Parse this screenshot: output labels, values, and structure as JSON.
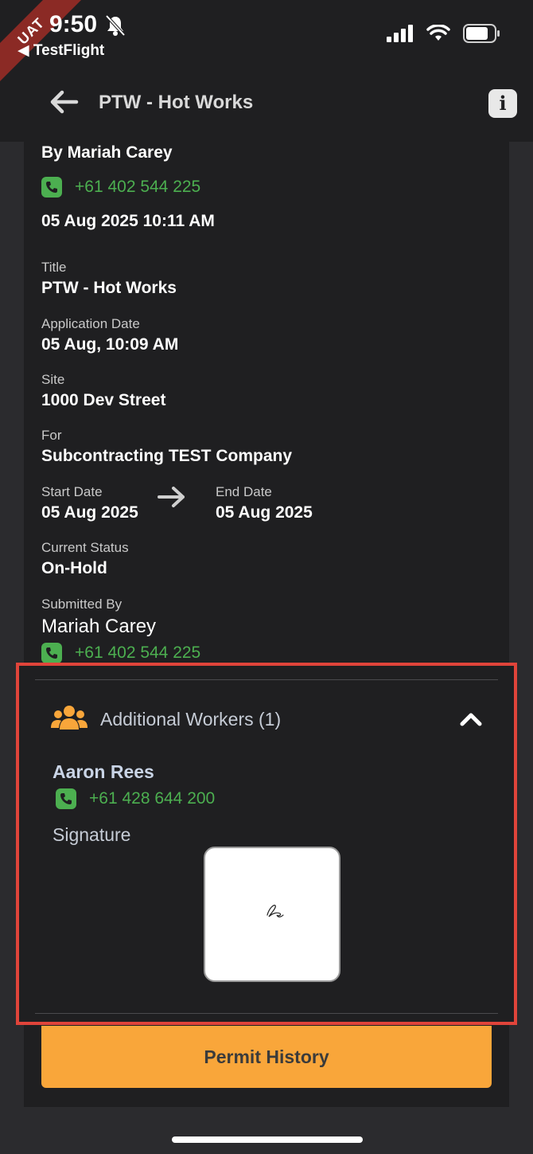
{
  "status_bar": {
    "ribbon": "UAT",
    "time": "9:50",
    "back_app": "◀ TestFlight"
  },
  "header": {
    "title": "PTW - Hot Works"
  },
  "summary": {
    "by": "By Mariah Carey",
    "phone": "+61 402 544 225",
    "datetime": "05 Aug 2025 10:11 AM"
  },
  "details": {
    "title_label": "Title",
    "title_value": "PTW - Hot Works",
    "application_date_label": "Application Date",
    "application_date_value": "05 Aug, 10:09 AM",
    "site_label": "Site",
    "site_value": "1000 Dev Street",
    "for_label": "For",
    "for_value": "Subcontracting TEST Company",
    "start_date_label": "Start Date",
    "start_date_value": "05 Aug 2025",
    "end_date_label": "End Date",
    "end_date_value": "05 Aug 2025",
    "status_label": "Current Status",
    "status_value": "On-Hold",
    "submitted_by_label": "Submitted By",
    "submitted_by_value": "Mariah Carey",
    "submitted_by_phone": "+61 402 544 225"
  },
  "additional_workers": {
    "title": "Additional Workers (1)",
    "worker_name": "Aaron Rees",
    "worker_phone": "+61 428 644 200",
    "signature_label": "Signature"
  },
  "actions": {
    "permit_history": "Permit History"
  },
  "colors": {
    "accent_orange": "#f9a63a",
    "phone_green": "#4caf50",
    "highlight_red": "#e0443a"
  }
}
